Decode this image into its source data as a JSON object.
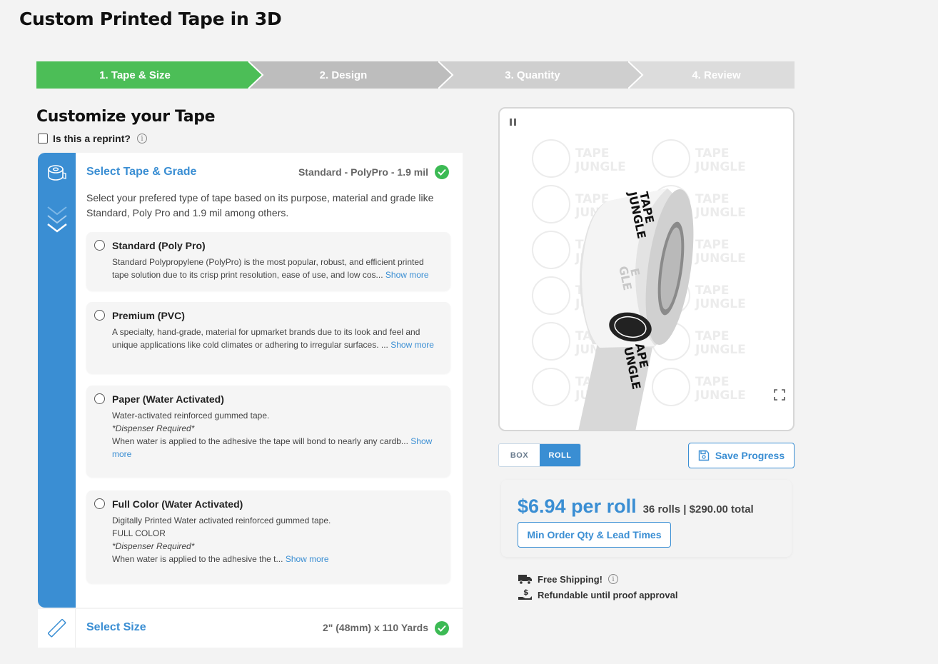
{
  "page": {
    "title": "Custom Printed Tape in 3D"
  },
  "steps": [
    {
      "label": "1. Tape & Size",
      "state": "active"
    },
    {
      "label": "2. Design",
      "state": "next"
    },
    {
      "label": "3. Quantity",
      "state": "upcoming"
    },
    {
      "label": "4. Review",
      "state": "upcoming"
    }
  ],
  "customize": {
    "title": "Customize your Tape",
    "reprint_label": "Is this a reprint?"
  },
  "tape_grade": {
    "title": "Select Tape & Grade",
    "selected": "Standard - PolyPro - 1.9 mil",
    "description": "Select your prefered type of tape based on its purpose, material and grade like Standard, Poly Pro and 1.9 mil among others.",
    "options": [
      {
        "title": "Standard (Poly Pro)",
        "line1": "Standard Polypropylene (PolyPro) is the most popular, robust, and efficient printed tape solution due to its crisp print resolution, ease of use, and low cos...",
        "more": "Show more"
      },
      {
        "title": "Premium (PVC)",
        "line1": "A specialty, hand-grade, material for upmarket brands due to its look and feel and unique applications like cold climates or adhering to irregular surfaces. ...",
        "more": "Show more"
      },
      {
        "title": "Paper (Water Activated)",
        "line1": "Water-activated reinforced gummed tape.",
        "line2": "*Dispenser Required*",
        "line3": "When water is applied to the adhesive the tape will bond to nearly any cardb...",
        "more": "Show more"
      },
      {
        "title": "Full Color (Water Activated)",
        "line1": "Digitally Printed Water activated reinforced gummed tape.",
        "line2": "FULL COLOR",
        "line3": "*Dispenser Required*",
        "line4": "When water is applied to the adhesive the t...",
        "more": "Show more"
      }
    ]
  },
  "size": {
    "title": "Select Size",
    "selected": "2\" (48mm) x 110 Yards"
  },
  "viewer": {
    "watermark_line1": "TAPE",
    "watermark_line2": "JUNGLE"
  },
  "view_toggle": {
    "box": "BOX",
    "roll": "ROLL",
    "active": "roll"
  },
  "save_label": "Save Progress",
  "pricing": {
    "price": "$6.94 per roll",
    "meta": "36 rolls | $290.00 total",
    "min_order": "Min Order Qty & Lead Times"
  },
  "shipping": {
    "free": "Free Shipping!",
    "refund": "Refundable until proof approval"
  },
  "colors": {
    "accent": "#3a8ed3",
    "success": "#3cba54",
    "step_active": "#4cbe57"
  }
}
